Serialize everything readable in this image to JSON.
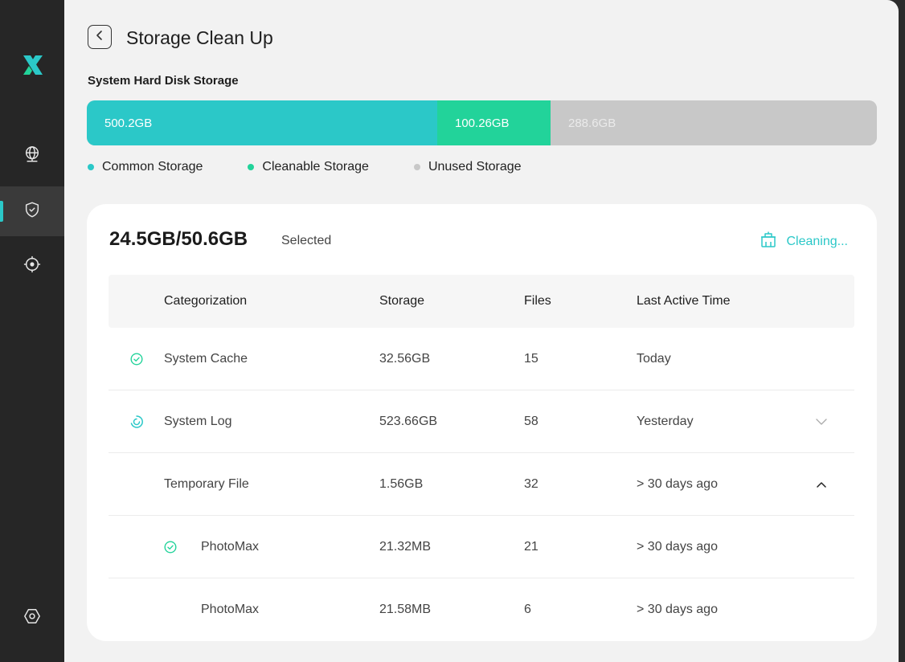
{
  "app": {
    "brand_color": "#2bc8c8"
  },
  "sidebar": {
    "logo": "x-logo",
    "items": [
      {
        "icon": "globe-icon",
        "active": false
      },
      {
        "icon": "shield-check-icon",
        "active": true
      },
      {
        "icon": "target-icon",
        "active": false
      }
    ],
    "bottom_icon": "hexagon-settings-icon"
  },
  "header": {
    "title": "Storage Clean Up",
    "back_icon": "chevron-left-icon"
  },
  "storage": {
    "label": "System Hard Disk Storage",
    "common": "500.2GB",
    "cleanable": "100.26GB",
    "unused": "288.6GB",
    "colors": {
      "common": "#2bc8c8",
      "cleanable": "#22d39a",
      "unused": "#c8c8c8"
    },
    "legend": {
      "common": "Common Storage",
      "cleanable": "Cleanable Storage",
      "unused": "Unused Storage"
    }
  },
  "card": {
    "selected_total": "24.5GB/50.6GB",
    "selected_label": "Selected",
    "cleaning_label": "Cleaning...",
    "cleaning_icon": "basket-icon"
  },
  "table": {
    "headers": {
      "categorization": "Categorization",
      "storage": "Storage",
      "files": "Files",
      "last_active": "Last Active Time"
    },
    "rows": [
      {
        "status": "checked",
        "name": "System Cache",
        "storage": "32.56GB",
        "files": "15",
        "time": "Today"
      },
      {
        "status": "loading",
        "name": "System Log",
        "storage": "523.66GB",
        "files": "58",
        "time": "Yesterday",
        "expand": "collapsed"
      },
      {
        "status": "none",
        "name": "Temporary File",
        "storage": "1.56GB",
        "files": "32",
        "time": "> 30 days ago",
        "expand": "expanded"
      },
      {
        "status": "checked",
        "name": "PhotoMax",
        "storage": "21.32MB",
        "files": "21",
        "time": "> 30 days ago",
        "sub": true
      },
      {
        "status": "none",
        "name": "PhotoMax",
        "storage": "21.58MB",
        "files": "6",
        "time": "> 30 days ago",
        "sub": true
      }
    ]
  }
}
